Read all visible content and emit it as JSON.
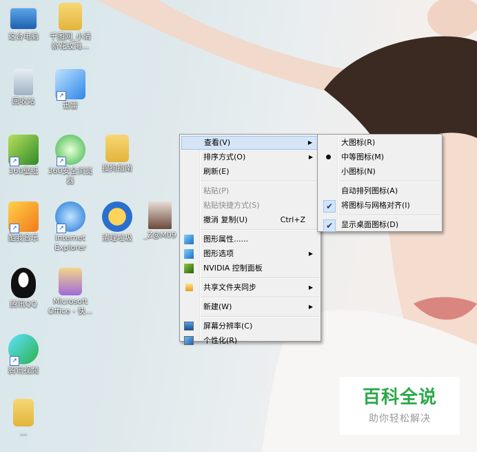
{
  "desktop_icons": [
    {
      "label": "这台电脑",
      "icon": "computer-icon"
    },
    {
      "label": "千图网_小清新花纹海...",
      "icon": "folder-icon"
    },
    {
      "label": "回收站",
      "icon": "recycle-bin-icon"
    },
    {
      "label": "迅雷",
      "icon": "xunlei-bird-icon"
    },
    {
      "label": "360壁纸",
      "icon": "wallpaper-app-icon"
    },
    {
      "label": "360安全浏览器",
      "icon": "browser-360-icon"
    },
    {
      "label": "搜狗指南",
      "icon": "folder-icon"
    },
    {
      "label": "酷我音乐",
      "icon": "kuwo-music-icon"
    },
    {
      "label": "Internet Explorer",
      "icon": "ie-icon"
    },
    {
      "label": "清理垃圾",
      "icon": "broom-icon"
    },
    {
      "label": "_Z@M09",
      "icon": "photo-thumbnail-icon"
    },
    {
      "label": "腾讯QQ",
      "icon": "qq-penguin-icon"
    },
    {
      "label": "Microsoft Office - 快...",
      "icon": "office-folder-icon"
    },
    {
      "label": "腾讯视频",
      "icon": "tencent-video-icon"
    },
    {
      "label": "...",
      "icon": "folder-icon"
    }
  ],
  "context_menu": {
    "items": [
      {
        "label": "查看(V)",
        "submenu": true
      },
      {
        "label": "排序方式(O)",
        "submenu": true
      },
      {
        "label": "刷新(E)"
      },
      {
        "label": "粘贴(P)"
      },
      {
        "label": "粘贴快捷方式(S)"
      },
      {
        "label": "撤消 复制(U)",
        "shortcut": "Ctrl+Z"
      },
      {
        "label": "图形属性......"
      },
      {
        "label": "图形选项",
        "submenu": true
      },
      {
        "label": "NVIDIA 控制面板"
      },
      {
        "label": "共享文件夹同步",
        "submenu": true
      },
      {
        "label": "新建(W)",
        "submenu": true
      },
      {
        "label": "屏幕分辨率(C)"
      },
      {
        "label": "个性化(R)"
      }
    ],
    "arrow_glyph": "▶"
  },
  "view_submenu": {
    "items": [
      {
        "label": "大图标(R)"
      },
      {
        "label": "中等图标(M)",
        "selected": true
      },
      {
        "label": "小图标(N)"
      },
      {
        "label": "自动排列图标(A)"
      },
      {
        "label": "将图标与网格对齐(I)",
        "checked": true
      },
      {
        "label": "显示桌面图标(D)",
        "checked": true
      }
    ],
    "check_glyph": "✔"
  },
  "watermark": {
    "title": "百科全说",
    "subtitle": "助你轻松解决"
  },
  "colors": {
    "highlight": "#d5e5f6",
    "highlight_border": "#9ec6ef",
    "watermark_green": "#2aa84a"
  }
}
